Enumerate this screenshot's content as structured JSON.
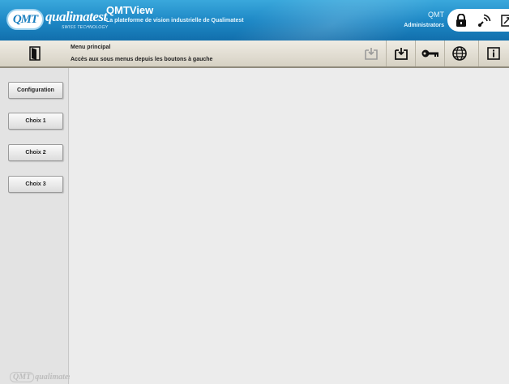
{
  "header": {
    "logo_text": "QMT",
    "brand": "qualimatest",
    "brand_sub": "SWISS TECHNOLOGY",
    "app_title": "QMTView",
    "app_subtitle": "La plateforme de vision industrielle de Qualimatest",
    "user_name": "QMT",
    "user_role": "Administrators",
    "icons": [
      "lock-icon",
      "signal-icon",
      "resize-icon"
    ]
  },
  "toolbar": {
    "menu_title": "Menu principal",
    "menu_help": "Accès aux sous menus depuis les boutons à gauche",
    "buttons": [
      "save-disabled-icon",
      "save-icon",
      "key-icon",
      "globe-icon",
      "info-icon"
    ]
  },
  "sidebar": {
    "items": [
      {
        "label": "Configuration"
      },
      {
        "label": "Choix 1"
      },
      {
        "label": "Choix 2"
      },
      {
        "label": "Choix 3"
      }
    ],
    "footer_logo_text": "QMT",
    "footer_brand": "qualimatest"
  },
  "colors": {
    "header_blue": "#1c86c4",
    "toolbar_beige": "#d6d1c3",
    "background": "#ececec"
  }
}
